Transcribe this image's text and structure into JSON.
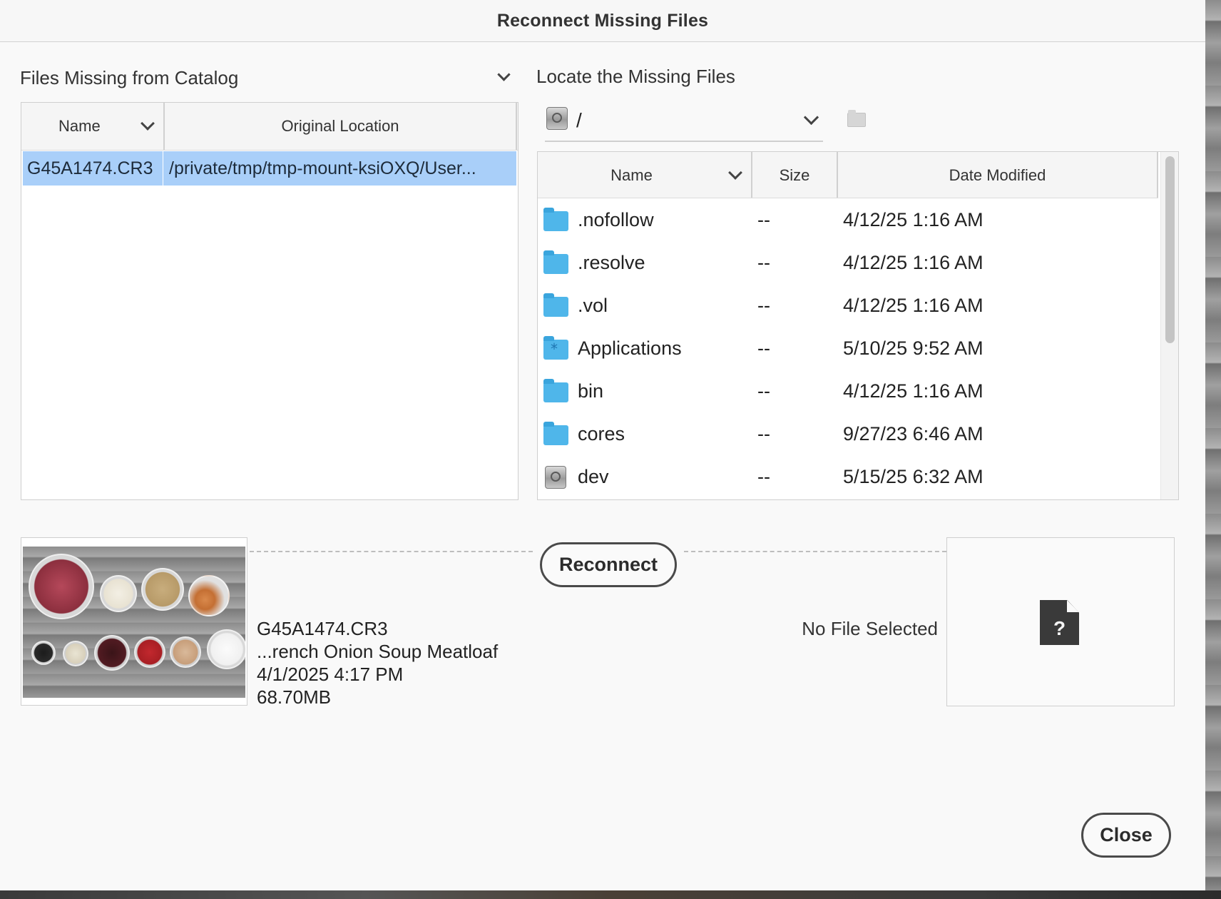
{
  "dialog": {
    "title": "Reconnect Missing Files"
  },
  "left_panel": {
    "label": "Files Missing from Catalog",
    "columns": [
      "Name",
      "Original Location"
    ],
    "rows": [
      {
        "name": "G45A1474.CR3",
        "location": "/private/tmp/tmp-mount-ksiOXQ/User..."
      }
    ]
  },
  "right_panel": {
    "label": "Locate the Missing Files",
    "path": "/",
    "columns": [
      "Name",
      "Size",
      "Date Modified"
    ],
    "rows": [
      {
        "icon": "folder-icon",
        "name": ".nofollow",
        "size": "--",
        "date": "4/12/25 1:16 AM"
      },
      {
        "icon": "folder-icon",
        "name": ".resolve",
        "size": "--",
        "date": "4/12/25 1:16 AM"
      },
      {
        "icon": "folder-icon",
        "name": ".vol",
        "size": "--",
        "date": "4/12/25 1:16 AM"
      },
      {
        "icon": "applications-folder-icon",
        "name": "Applications",
        "size": "--",
        "date": "5/10/25 9:52 AM"
      },
      {
        "icon": "folder-icon",
        "name": "bin",
        "size": "--",
        "date": "4/12/25 1:16 AM"
      },
      {
        "icon": "folder-icon",
        "name": "cores",
        "size": "--",
        "date": "9/27/23 6:46 AM"
      },
      {
        "icon": "disk-icon",
        "name": "dev",
        "size": "--",
        "date": "5/15/25 6:32 AM"
      }
    ]
  },
  "selected_file": {
    "name": "G45A1474.CR3",
    "folder": "...rench Onion Soup Meatloaf",
    "date": "4/1/2025 4:17 PM",
    "size": "68.70MB"
  },
  "actions": {
    "reconnect_label": "Reconnect",
    "close_label": "Close"
  },
  "target": {
    "status": "No File Selected"
  }
}
